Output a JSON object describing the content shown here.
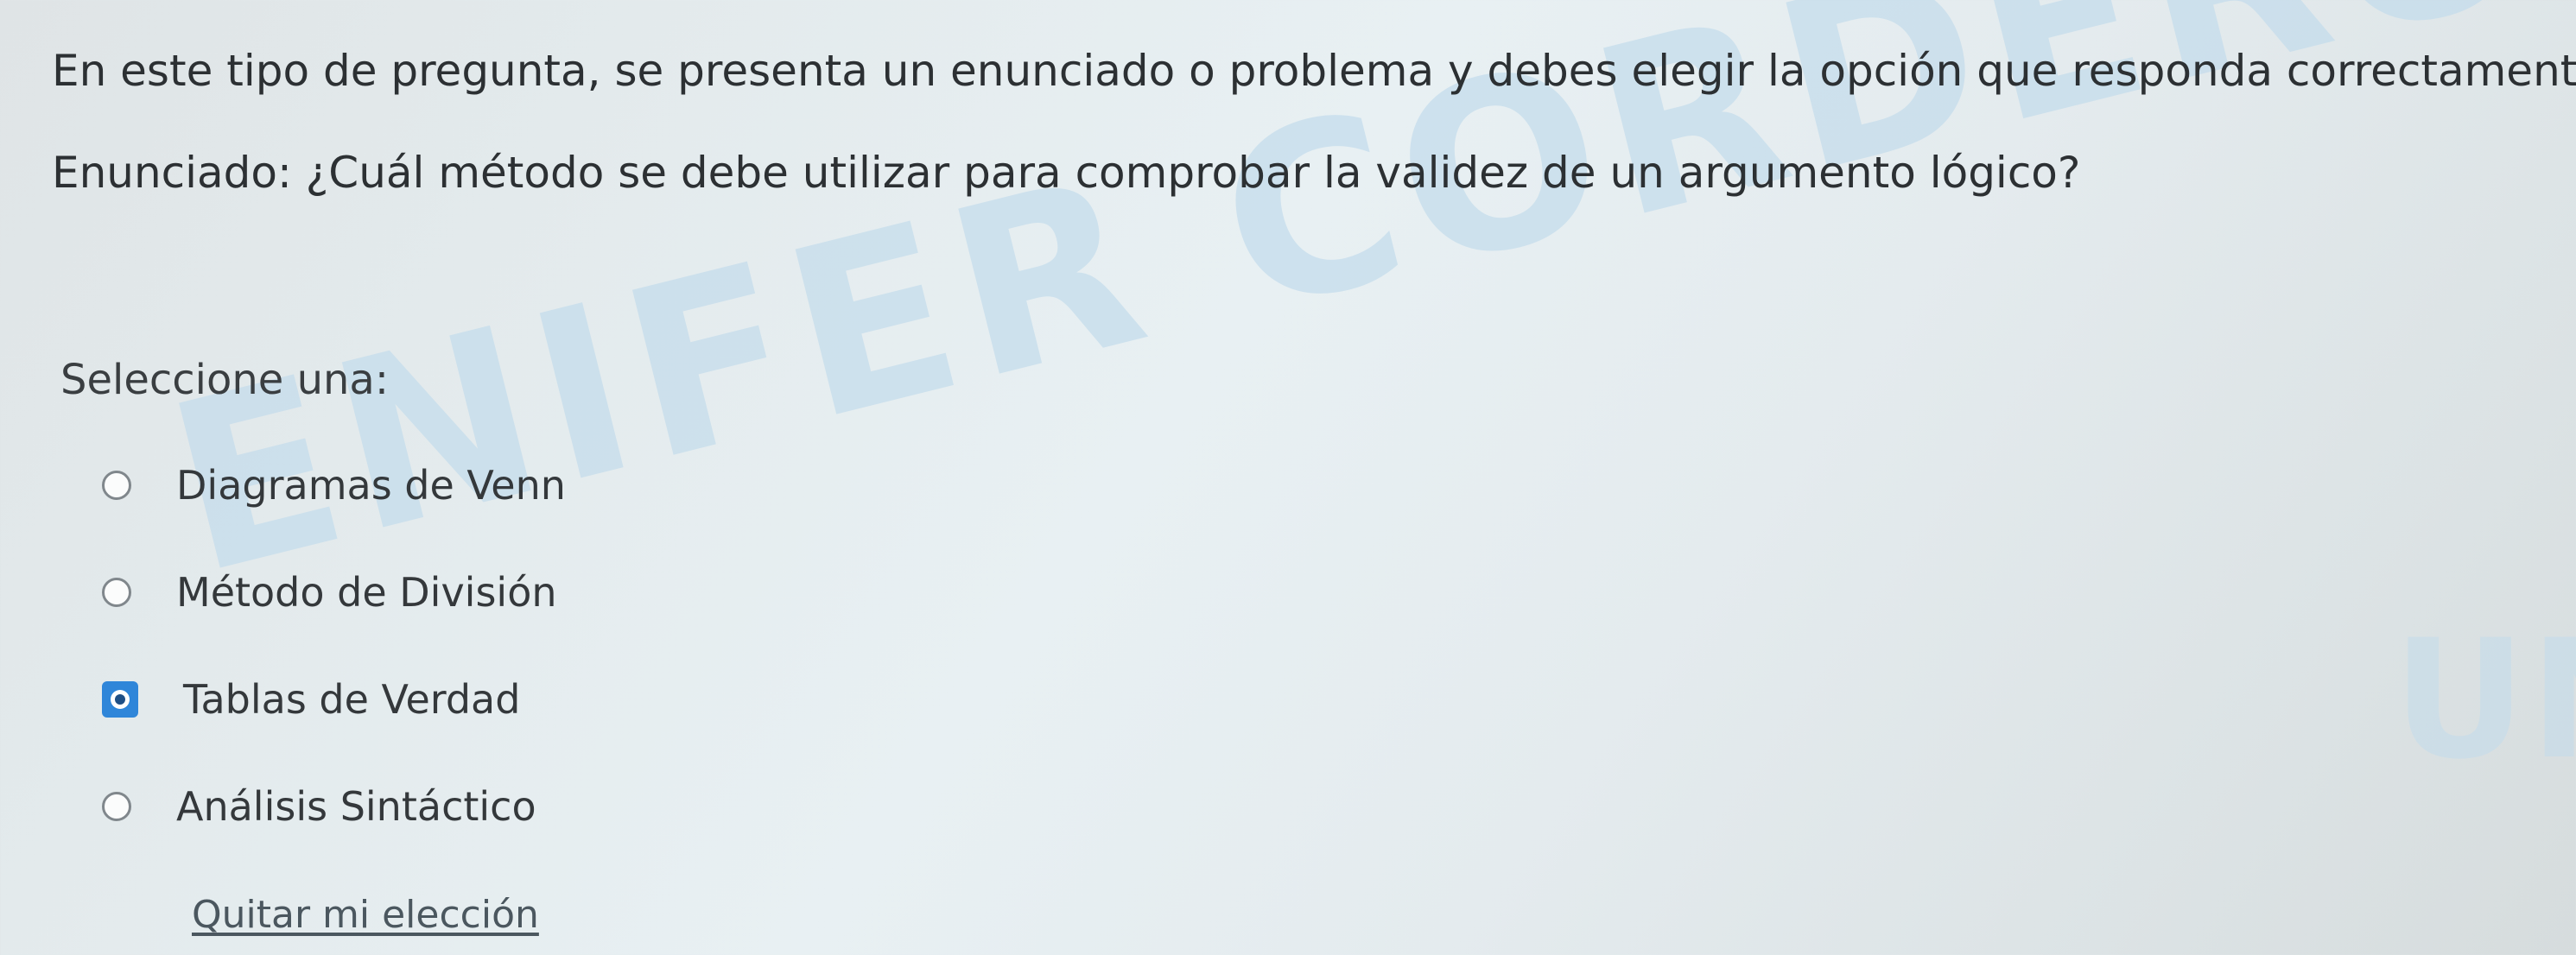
{
  "question": {
    "instruction": "En este tipo de pregunta, se presenta un enunciado o problema y debes elegir la opción que responda correctamente.",
    "statement": "Enunciado: ¿Cuál método se debe utilizar para comprobar la validez de un argumento lógico?",
    "prompt": "Seleccione una:"
  },
  "options": [
    {
      "label": "Diagramas de Venn",
      "selected": false
    },
    {
      "label": "Método de División",
      "selected": false
    },
    {
      "label": "Tablas de Verdad",
      "selected": true
    },
    {
      "label": "Análisis Sintáctico",
      "selected": false
    }
  ],
  "clear_choice_label": "Quitar mi elección",
  "watermark": {
    "main": "ENIFER CORDERO BEDOY",
    "side": "UN"
  },
  "colors": {
    "selected_radio": "#2f86d9",
    "watermark": "#c3dcec"
  }
}
